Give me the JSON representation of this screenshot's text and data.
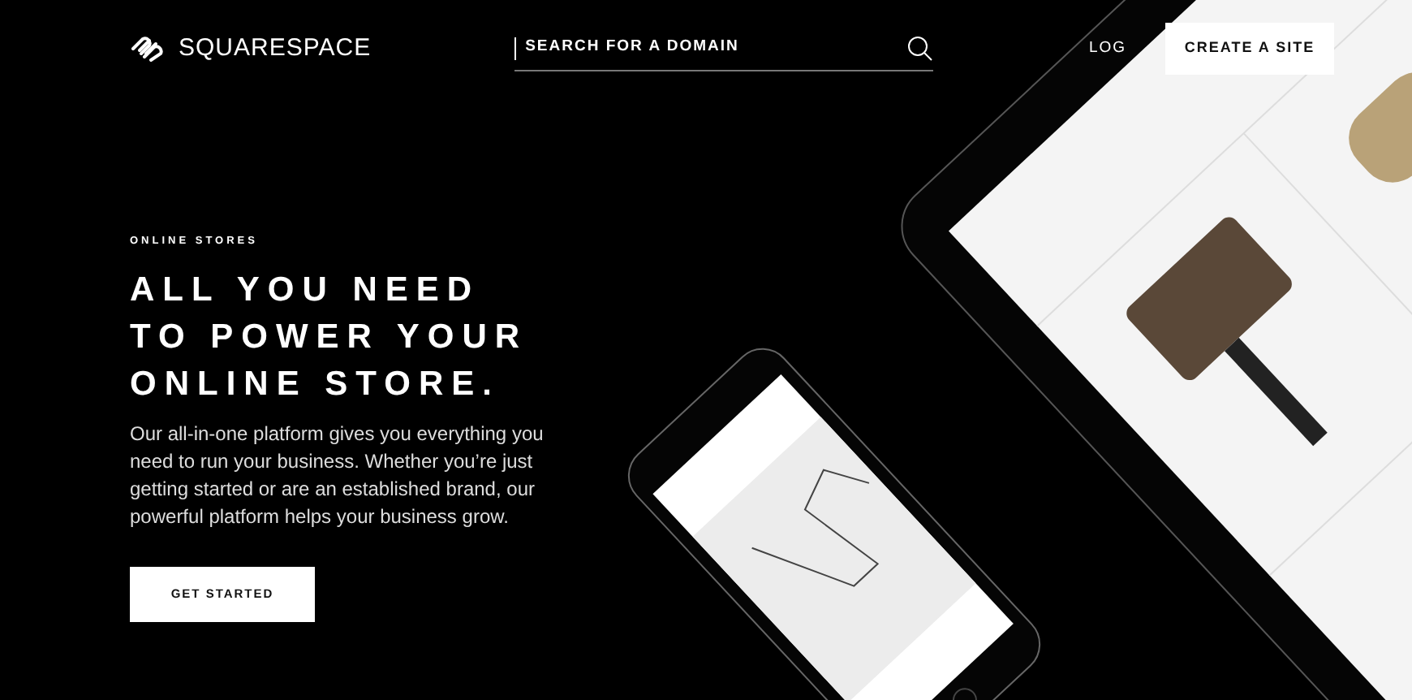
{
  "navbar": {
    "brand": "SQUARESPACE",
    "search": {
      "placeholder": "SEARCH FOR A DOMAIN"
    },
    "links": [
      "LOG"
    ],
    "cta": "CREATE A SITE"
  },
  "hero": {
    "eyebrow": "ONLINE STORES",
    "headline": [
      "ALL YOU NEED",
      "TO POWER YOUR",
      "ONLINE STORE."
    ],
    "body": "Our all-in-one platform gives you everything you need to run your business. Whether you’re just getting started or are an established brand, our powerful platform helps your business grow.",
    "button": "GET STARTED"
  }
}
